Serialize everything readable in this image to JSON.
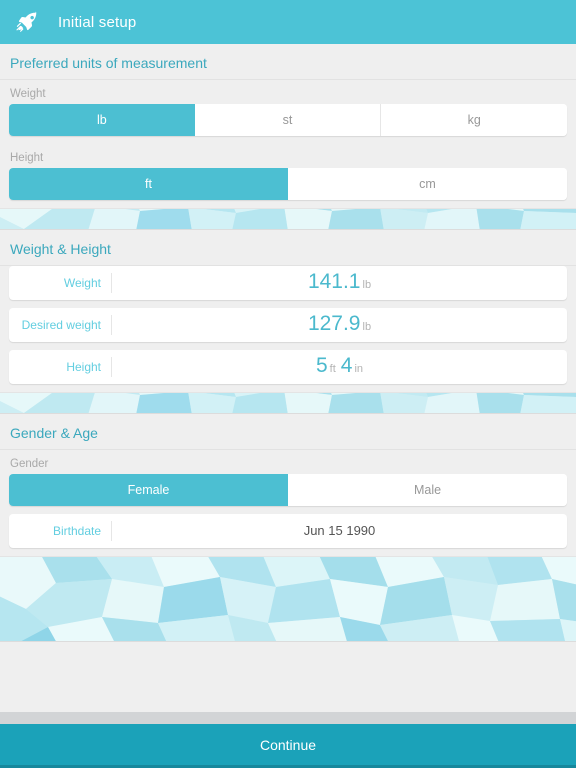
{
  "header": {
    "icon": "rocket-icon",
    "title": "Initial setup",
    "bg_color": "#4cc3d6"
  },
  "units_section": {
    "title": "Preferred units of measurement",
    "weight": {
      "label": "Weight",
      "options": [
        "lb",
        "st",
        "kg"
      ],
      "selected": "lb"
    },
    "height": {
      "label": "Height",
      "options": [
        "ft",
        "cm"
      ],
      "selected": "ft"
    }
  },
  "measurements_section": {
    "title": "Weight & Height",
    "rows": [
      {
        "label": "Weight",
        "value": "141.1",
        "unit": "lb"
      },
      {
        "label": "Desired weight",
        "value": "127.9",
        "unit": "lb"
      },
      {
        "label": "Height",
        "value": "5",
        "unit": "ft",
        "value2": "4",
        "unit2": "in"
      }
    ]
  },
  "gender_section": {
    "title": "Gender & Age",
    "gender": {
      "label": "Gender",
      "options": [
        "Female",
        "Male"
      ],
      "selected": "Female"
    },
    "birthdate": {
      "label": "Birthdate",
      "value": "Jun 15 1990"
    }
  },
  "footer": {
    "continue_label": "Continue",
    "accent_color": "#1ba2b9"
  },
  "theme": {
    "accent": "#4cbfd2",
    "accent_dark": "#1ba2b9",
    "section_title": "#3ba8bd",
    "value_text": "#4bb9cd",
    "muted": "#a9a9a9",
    "page_bg": "#efefef"
  }
}
